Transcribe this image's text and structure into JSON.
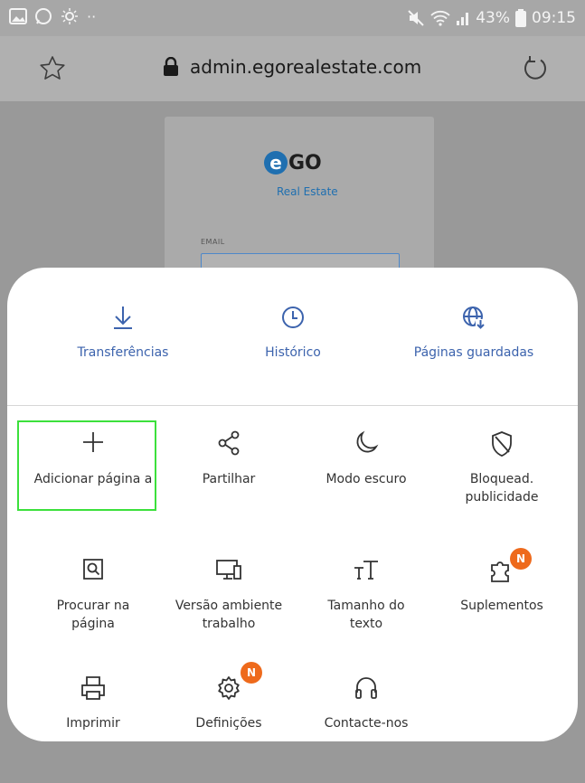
{
  "status_bar": {
    "battery": "43%",
    "time": "09:15"
  },
  "browser": {
    "url": "admin.egorealestate.com"
  },
  "page": {
    "logo_text": "GO",
    "logo_letter": "e",
    "logo_subtitle": "Real Estate",
    "email_label": "EMAIL"
  },
  "menu": {
    "top": [
      {
        "label": "Transferências",
        "icon": "download-icon"
      },
      {
        "label": "Histórico",
        "icon": "clock-icon"
      },
      {
        "label": "Páginas guardadas",
        "icon": "saved-pages-icon"
      }
    ],
    "grid": [
      {
        "label": "Adicionar página a",
        "icon": "plus-icon"
      },
      {
        "label": "Partilhar",
        "icon": "share-icon"
      },
      {
        "label": "Modo escuro",
        "icon": "moon-icon"
      },
      {
        "label": "Bloquead. publicidade",
        "icon": "shield-icon"
      },
      {
        "label": "Procurar na página",
        "icon": "find-in-page-icon"
      },
      {
        "label": "Versão ambiente trabalho",
        "icon": "desktop-icon"
      },
      {
        "label": "Tamanho do texto",
        "icon": "text-size-icon"
      },
      {
        "label": "Suplementos",
        "icon": "puzzle-icon",
        "badge": "N"
      },
      {
        "label": "Imprimir",
        "icon": "printer-icon"
      },
      {
        "label": "Definições",
        "icon": "gear-icon",
        "badge": "N"
      },
      {
        "label": "Contacte-nos",
        "icon": "headset-icon"
      }
    ]
  },
  "colors": {
    "accent": "#3c63ad",
    "badge": "#ee6a1c",
    "highlight": "#3ce03c"
  }
}
